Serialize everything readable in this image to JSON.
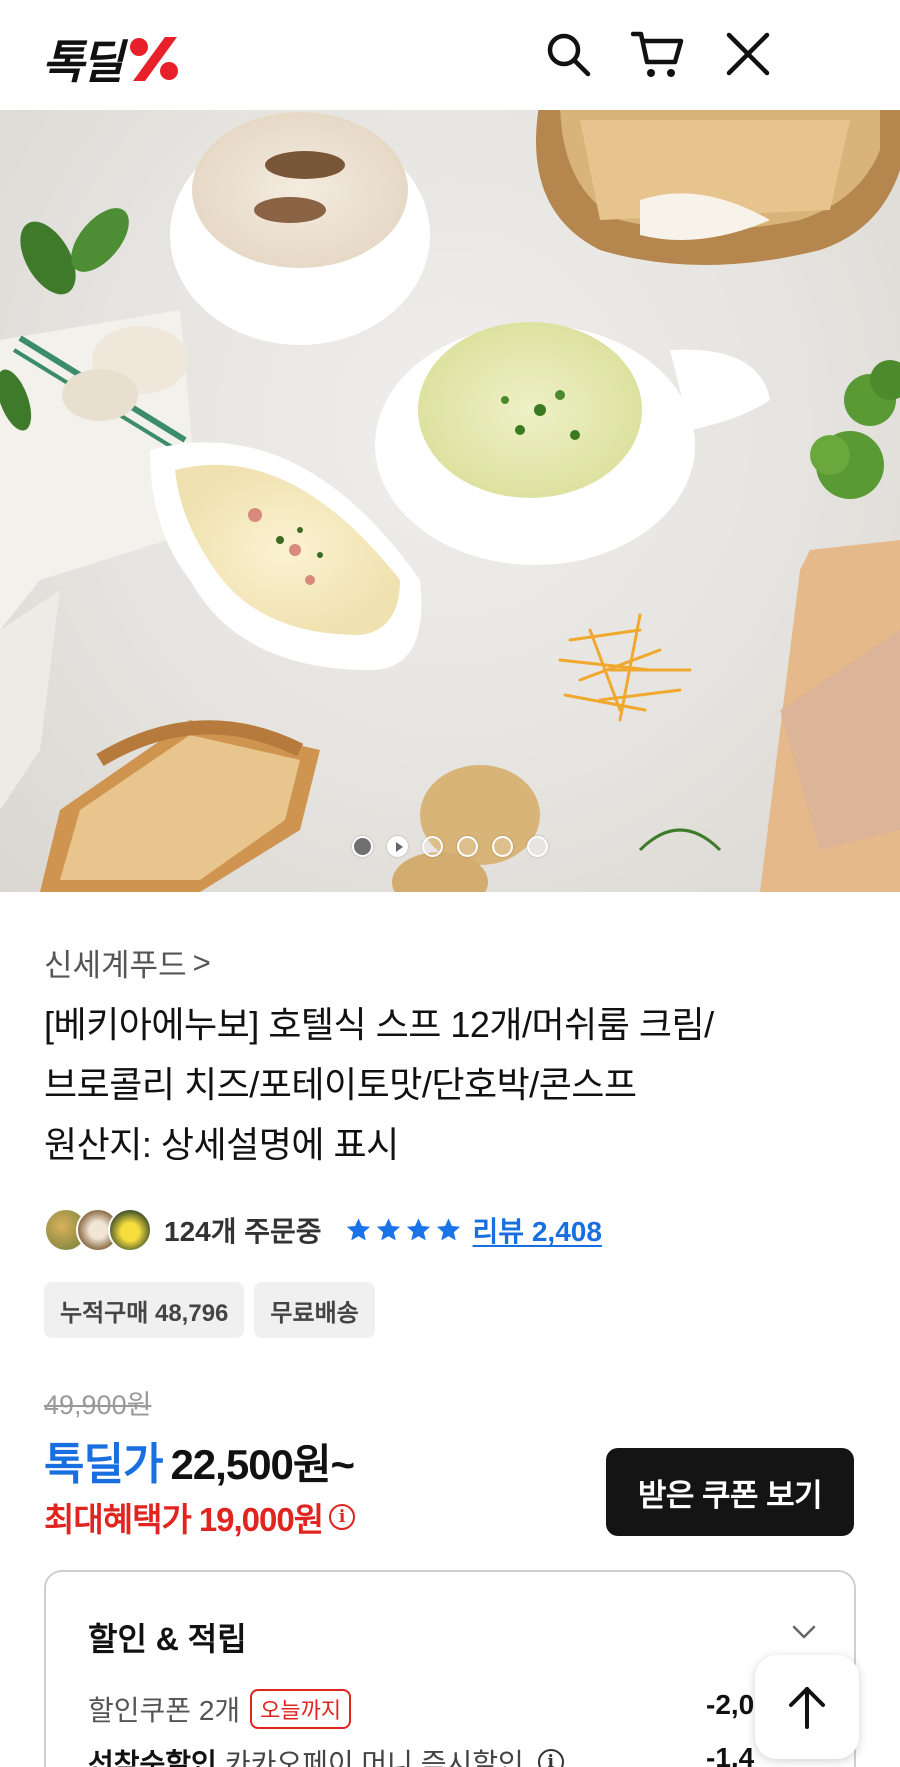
{
  "header": {
    "logo_text": "톡딜",
    "logo_accent_color": "#e8202a",
    "icons": [
      "search-icon",
      "cart-icon",
      "close-icon"
    ]
  },
  "hero": {
    "slide_count": 6,
    "active_index": 0
  },
  "product": {
    "brand": "신세계푸드",
    "brand_chevron": ">",
    "title_lines": [
      "[베키아에누보] 호텔식 스프 12개/머쉬룸 크림/",
      "브로콜리 치즈/포테이토맛/단호박/콘스프",
      "원산지: 상세설명에 표시"
    ],
    "orders_text": "124개 주문중",
    "rating_stars": 4,
    "review_text": "리뷰 2,408",
    "tags": [
      "누적구매 48,796",
      "무료배송"
    ]
  },
  "price": {
    "original": "49,900원",
    "deal_label": "톡딜가",
    "deal_price": "22,500원~",
    "max_label": "최대혜택가",
    "max_price": "19,000원",
    "coupon_button": "받은 쿠폰 보기",
    "accent_blue": "#1a6fe0",
    "accent_red": "#e0241f"
  },
  "benefits": {
    "title": "할인 & 적립",
    "rows": [
      {
        "label": "할인쿠폰 2개",
        "badge": "오늘까지",
        "amount": "-2,0"
      },
      {
        "label_strong": "선착순할인",
        "label": "카카오페이 머니 즉시할인",
        "amount": "-1,4"
      }
    ]
  },
  "floating": {
    "scroll_top_icon": "arrow-up-icon"
  }
}
